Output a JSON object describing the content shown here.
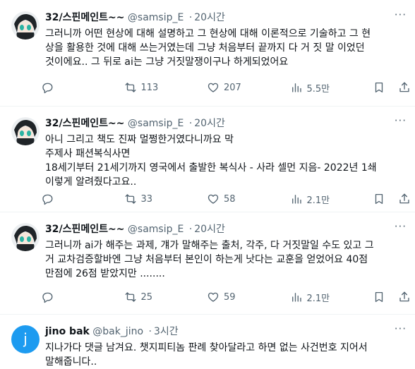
{
  "tweets": [
    {
      "name": "32/스핀메인트~~",
      "handle": "@samsip_E",
      "dot": "·",
      "time": "20시간",
      "more": "···",
      "lines": [
        "그러니까 어떤 현상에 대해 설명하고 그 현상에 대해 이론적으로 기술하고 그 현",
        "상을 활용한 것에 대해 쓰는거였는데 그냥 처음부터 끝까지 다 거 짓 말 이었던",
        "것이에요.. 그 뒤로 ai는 그냥 거짓말쟁이구나 하게되었어요"
      ],
      "retweets": "113",
      "likes": "207",
      "views": "5.5만"
    },
    {
      "name": "32/스핀메인트~~",
      "handle": "@samsip_E",
      "dot": "·",
      "time": "20시간",
      "more": "···",
      "lines": [
        "아니 그리고 책도 진짜 멀쩡한거였다니까요 막",
        "주제사 패션복식사면",
        "18세기부터 21세기까지 영국에서 출발한 복식사 - 사라 셀먼 지음- 2022년 1쇄",
        "이렇게 알려줬다고요.."
      ],
      "retweets": "33",
      "likes": "58",
      "views": "2.1만"
    },
    {
      "name": "32/스핀메인트~~",
      "handle": "@samsip_E",
      "dot": "·",
      "time": "20시간",
      "more": "···",
      "lines": [
        "그러니까 ai가 해주는 과제, 걔가 말해주는 출처, 각주, 다 거짓말일 수도 있고 그",
        "거 교차검증할바엔 그냥 처음부터 본인이 하는게 낫다는 교훈을 얻었어요 40점",
        "만점에 26점 받았지만 ........"
      ],
      "retweets": "25",
      "likes": "59",
      "views": "2.1만"
    },
    {
      "name": "jino bak",
      "handle": "@bak_jino",
      "dot": "·",
      "time": "3시간",
      "more": "···",
      "avatar_letter": "j",
      "lines": [
        "지나가다 댓글 남겨요. 챗지피티놈 판례 찾아달라고 하면 없는 사건번호 지어서",
        "말해줍니다.."
      ]
    }
  ],
  "colors": {
    "avatar_j": "#1d9bf0",
    "muted": "#536471",
    "text": "#0f1419"
  }
}
